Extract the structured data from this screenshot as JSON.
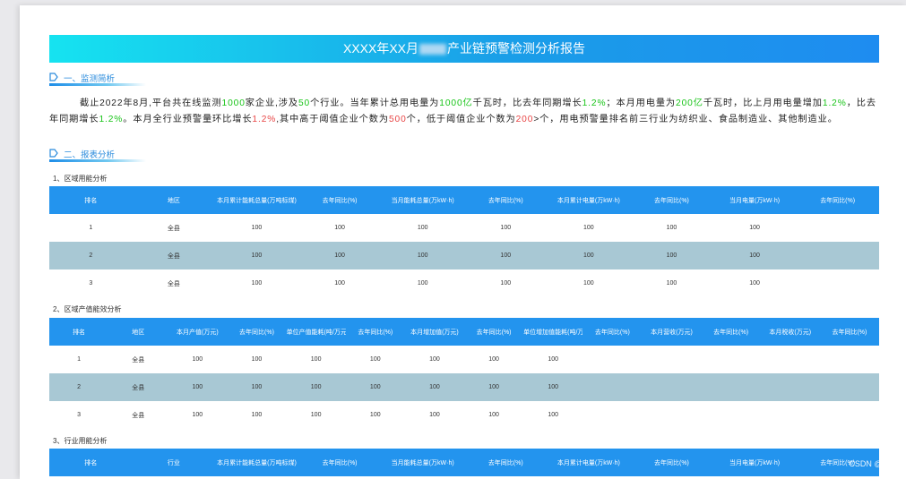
{
  "report": {
    "title_prefix": "XXXX年XX月",
    "title_suffix": "产业链预警检测分析报告"
  },
  "sections": {
    "monitor": "一、监测简析",
    "report": "二、报表分析"
  },
  "intro": {
    "p1": "截止2022年8月,平台共在线监测",
    "v1": "1000",
    "p2": "家企业,涉及",
    "v2": "50",
    "p3": "个行业。当年累计总用电量为",
    "v3": "1000亿",
    "p4": "千瓦时，比去年同期增长",
    "v4": "1.2%",
    "p5": "；本月用电量为",
    "v5": "200亿",
    "p6": "千瓦时，比上月用电量增加",
    "v6": "1.2%",
    "p7": "，比去年同期增长",
    "v7": "1.2%",
    "p8": "。本月全行业预警量环比增长",
    "v8": "1.2%",
    "p9": ",其中高于阈值企业个数为",
    "v9": "500",
    "p10": "个，低于阈值企业个数为",
    "v10": "200",
    "p11": ">个，用电预警量排名前三行业为纺织业、食品制造业、其他制造业。"
  },
  "table1": {
    "title": "1、区域用能分析",
    "headers": [
      "排名",
      "地区",
      "本月累计能耗总量(万吨标煤)",
      "去年同比(%)",
      "当月能耗总量(万kW·h)",
      "去年同比(%)",
      "本月累计电量(万kW·h)",
      "去年同比(%)",
      "当月电量(万kW·h)",
      "去年同比(%)"
    ],
    "rows": [
      [
        "1",
        "全县",
        "100",
        "100",
        "100",
        "100",
        "100",
        "100",
        "100",
        ""
      ],
      [
        "2",
        "全县",
        "100",
        "100",
        "100",
        "100",
        "100",
        "100",
        "100",
        ""
      ],
      [
        "3",
        "全县",
        "100",
        "100",
        "100",
        "100",
        "100",
        "100",
        "100",
        ""
      ]
    ]
  },
  "table2": {
    "title": "2、区域产值能效分析",
    "headers": [
      "排名",
      "地区",
      "本月产值(万元)",
      "去年同比(%)",
      "单位产值能耗(吨/万元)",
      "去年同比(%)",
      "本月增加值(万元)",
      "去年同比(%)",
      "单位增加值能耗(吨/万元)",
      "去年同比(%)",
      "本月营收(万元)",
      "去年同比(%)",
      "本月税收(万元)",
      "去年同比(%)"
    ],
    "rows": [
      [
        "1",
        "全县",
        "100",
        "100",
        "100",
        "100",
        "100",
        "100",
        "100",
        "",
        "",
        "",
        "",
        ""
      ],
      [
        "2",
        "全县",
        "100",
        "100",
        "100",
        "100",
        "100",
        "100",
        "100",
        "",
        "",
        "",
        "",
        ""
      ],
      [
        "3",
        "全县",
        "100",
        "100",
        "100",
        "100",
        "100",
        "100",
        "100",
        "",
        "",
        "",
        "",
        ""
      ]
    ]
  },
  "table3": {
    "title": "3、行业用能分析",
    "headers": [
      "排名",
      "行业",
      "本月累计能耗总量(万吨标煤)",
      "去年同比(%)",
      "当月能耗总量(万kW·h)",
      "去年同比(%)",
      "本月累计电量(万kW·h)",
      "去年同比(%)",
      "当月电量(万kW·h)",
      "去年同比(%)"
    ]
  },
  "watermark": "CSDN @jion j",
  "colors": {
    "title_gradient_start": "#16e3f0",
    "title_gradient_end": "#1e8cf0",
    "table_header": "#2394ee",
    "alt_row": "#a8c8d4",
    "highlight_green": "#18c418",
    "highlight_red": "#e84545"
  }
}
